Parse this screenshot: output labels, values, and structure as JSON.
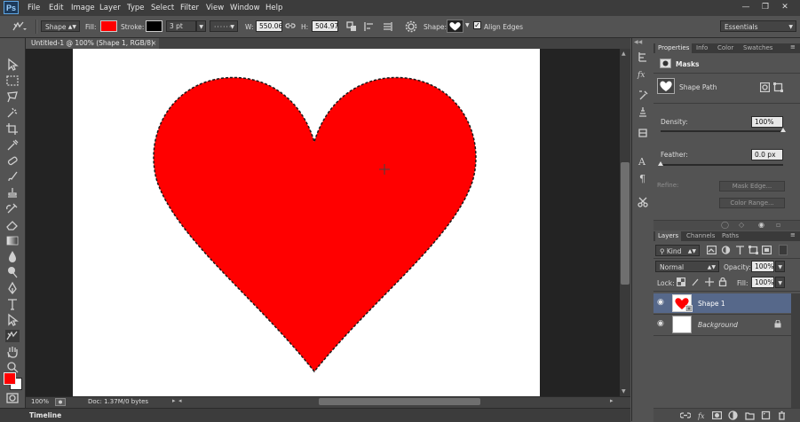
{
  "app": {
    "logo": "Ps",
    "menu": [
      "File",
      "Edit",
      "Image",
      "Layer",
      "Type",
      "Select",
      "Filter",
      "View",
      "Window",
      "Help"
    ],
    "window_controls": [
      "minimize-icon",
      "restore-icon",
      "close-icon"
    ]
  },
  "options_bar": {
    "tool_mode": "Shape",
    "fill_label": "Fill:",
    "fill_color": "#ff0000",
    "stroke_label": "Stroke:",
    "stroke_color": "#000000",
    "stroke_width": "3 pt",
    "w_label": "W:",
    "w_value": "550.06",
    "h_label": "H:",
    "h_value": "504.97",
    "shape_label": "Shape:",
    "align_edges_label": "Align Edges",
    "align_edges_checked": true,
    "workspace": "Essentials"
  },
  "document": {
    "tab_title": "Untitled-1 @ 100% (Shape 1, RGB/8) *",
    "zoom": "100%",
    "doc_info": "Doc: 1.37M/0 bytes",
    "heart_color": "#ff0000"
  },
  "timeline": {
    "label": "Timeline"
  },
  "properties_panel": {
    "tabs": [
      "Properties",
      "Info",
      "Color",
      "Swatches"
    ],
    "section": "Masks",
    "shape_path_label": "Shape Path",
    "density_label": "Density:",
    "density_value": "100%",
    "density_level": 1.0,
    "feather_label": "Feather:",
    "feather_value": "0.0 px",
    "feather_level": 0.0,
    "refine_label": "Refine:",
    "mask_edge_button": "Mask Edge...",
    "color_range_button": "Color Range..."
  },
  "layers_panel": {
    "tabs": [
      "Layers",
      "Channels",
      "Paths"
    ],
    "kind_filter": "Kind",
    "blend_mode": "Normal",
    "opacity_label": "Opacity:",
    "opacity_value": "100%",
    "lock_label": "Lock:",
    "fill_label": "Fill:",
    "fill_value": "100%",
    "layers": [
      {
        "name": "Shape 1",
        "selected": true,
        "locked": false
      },
      {
        "name": "Background",
        "selected": false,
        "locked": true
      }
    ]
  },
  "colors": {
    "foreground": "#ff0000",
    "background": "#ffffff"
  }
}
